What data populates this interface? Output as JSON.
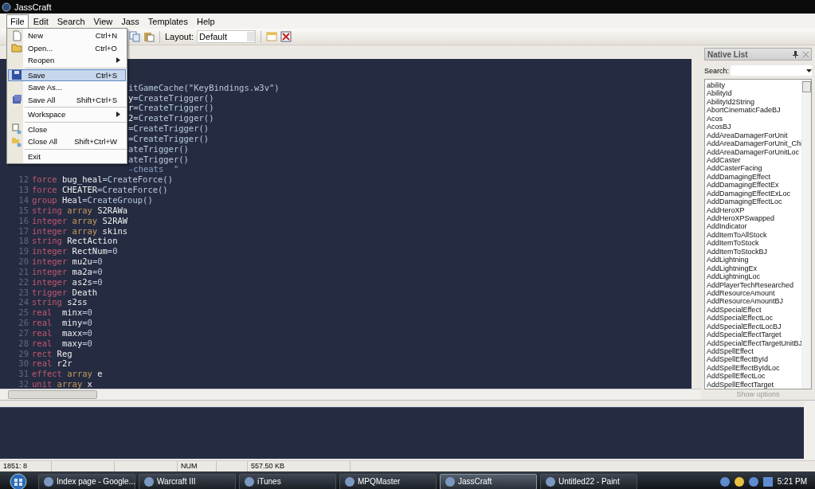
{
  "window": {
    "title": "JassCraft"
  },
  "menu_bar": [
    {
      "label": "File",
      "selected": true
    },
    {
      "label": "Edit",
      "selected": false
    },
    {
      "label": "Search",
      "selected": false
    },
    {
      "label": "View",
      "selected": false
    },
    {
      "label": "Jass",
      "selected": false
    },
    {
      "label": "Templates",
      "selected": false
    },
    {
      "label": "Help",
      "selected": false
    }
  ],
  "file_menu": [
    {
      "kind": "item",
      "label": "New",
      "shortcut": "Ctrl+N",
      "selected": false
    },
    {
      "kind": "item",
      "label": "Open...",
      "shortcut": "Ctrl+O",
      "selected": false
    },
    {
      "kind": "submenu",
      "label": "Reopen",
      "selected": false
    },
    {
      "kind": "separator"
    },
    {
      "kind": "item",
      "label": "Save",
      "shortcut": "Ctrl+S",
      "selected": true
    },
    {
      "kind": "item",
      "label": "Save As...",
      "selected": false
    },
    {
      "kind": "item",
      "label": "Save All",
      "shortcut": "Shift+Ctrl+S",
      "selected": false
    },
    {
      "kind": "separator"
    },
    {
      "kind": "submenu",
      "label": "Workspace",
      "selected": false
    },
    {
      "kind": "separator"
    },
    {
      "kind": "item",
      "label": "Close",
      "selected": false
    },
    {
      "kind": "item",
      "label": "Close All",
      "shortcut": "Shift+Ctrl+W",
      "selected": false
    },
    {
      "kind": "separator"
    },
    {
      "kind": "item",
      "label": "Exit",
      "selected": false
    }
  ],
  "toolbar": {
    "layout_label": "Layout:",
    "layout_value": "Default"
  },
  "editor": {
    "partial_lines": [
      [
        {
          "kind": "call",
          "text": "itGameCache(\"KeyBindings.w3v\")"
        }
      ],
      [
        {
          "kind": "ident",
          "text": "y"
        },
        {
          "kind": "call",
          "text": "=CreateTrigger()"
        }
      ],
      [
        {
          "kind": "ident",
          "text": "r"
        },
        {
          "kind": "call",
          "text": "=CreateTrigger()"
        }
      ],
      [
        {
          "kind": "ident",
          "text": "2"
        },
        {
          "kind": "call",
          "text": "=CreateTrigger()"
        }
      ],
      [
        {
          "kind": "call",
          "text": "=CreateTrigger()"
        }
      ],
      [
        {
          "kind": "call",
          "text": "=CreateTrigger()"
        }
      ],
      [
        {
          "kind": "call",
          "text": "ateTrigger()"
        }
      ],
      [
        {
          "kind": "call",
          "text": "ateTrigger()"
        }
      ],
      [
        {
          "kind": "string",
          "text": "-cheats  \""
        }
      ]
    ],
    "lines": [
      {
        "number": "12",
        "tokens": [
          {
            "kind": "type",
            "text": "force"
          },
          {
            "kind": "ident",
            "text": " bug_heal"
          },
          {
            "kind": "call",
            "text": "=CreateForce()"
          }
        ]
      },
      {
        "number": "13",
        "tokens": [
          {
            "kind": "type",
            "text": "force"
          },
          {
            "kind": "ident",
            "text": " CHEATER"
          },
          {
            "kind": "call",
            "text": "=CreateForce()"
          }
        ]
      },
      {
        "number": "14",
        "tokens": [
          {
            "kind": "type",
            "text": "group"
          },
          {
            "kind": "ident",
            "text": " Heal"
          },
          {
            "kind": "call",
            "text": "=CreateGroup()"
          }
        ]
      },
      {
        "number": "15",
        "tokens": [
          {
            "kind": "type",
            "text": "string"
          },
          {
            "kind": "keyword",
            "text": " array"
          },
          {
            "kind": "ident",
            "text": " S2RAWa"
          }
        ]
      },
      {
        "number": "16",
        "tokens": [
          {
            "kind": "type",
            "text": "integer"
          },
          {
            "kind": "keyword",
            "text": " array"
          },
          {
            "kind": "ident",
            "text": " S2RAW"
          }
        ]
      },
      {
        "number": "17",
        "tokens": [
          {
            "kind": "type",
            "text": "integer"
          },
          {
            "kind": "keyword",
            "text": " array"
          },
          {
            "kind": "ident",
            "text": " skins"
          }
        ]
      },
      {
        "number": "18",
        "tokens": [
          {
            "kind": "type",
            "text": "string"
          },
          {
            "kind": "ident",
            "text": " RectAction"
          }
        ]
      },
      {
        "number": "19",
        "tokens": [
          {
            "kind": "type",
            "text": "integer"
          },
          {
            "kind": "ident",
            "text": " RectNum"
          },
          {
            "kind": "call",
            "text": "=0"
          }
        ]
      },
      {
        "number": "20",
        "tokens": [
          {
            "kind": "type",
            "text": "integer"
          },
          {
            "kind": "ident",
            "text": " mu2u"
          },
          {
            "kind": "call",
            "text": "=0"
          }
        ]
      },
      {
        "number": "21",
        "tokens": [
          {
            "kind": "type",
            "text": "integer"
          },
          {
            "kind": "ident",
            "text": " ma2a"
          },
          {
            "kind": "call",
            "text": "=0"
          }
        ]
      },
      {
        "number": "22",
        "tokens": [
          {
            "kind": "type",
            "text": "integer"
          },
          {
            "kind": "ident",
            "text": " as2s"
          },
          {
            "kind": "call",
            "text": "=0"
          }
        ]
      },
      {
        "number": "23",
        "tokens": [
          {
            "kind": "type",
            "text": "trigger"
          },
          {
            "kind": "ident",
            "text": " Death"
          }
        ]
      },
      {
        "number": "24",
        "tokens": [
          {
            "kind": "type",
            "text": "string"
          },
          {
            "kind": "ident",
            "text": " s2ss"
          }
        ]
      },
      {
        "number": "25",
        "tokens": [
          {
            "kind": "type",
            "text": "real"
          },
          {
            "kind": "ident",
            "text": "  minx"
          },
          {
            "kind": "call",
            "text": "=0"
          }
        ]
      },
      {
        "number": "26",
        "tokens": [
          {
            "kind": "type",
            "text": "real"
          },
          {
            "kind": "ident",
            "text": "  miny"
          },
          {
            "kind": "call",
            "text": "=0"
          }
        ]
      },
      {
        "number": "27",
        "tokens": [
          {
            "kind": "type",
            "text": "real"
          },
          {
            "kind": "ident",
            "text": "  maxx"
          },
          {
            "kind": "call",
            "text": "=0"
          }
        ]
      },
      {
        "number": "28",
        "tokens": [
          {
            "kind": "type",
            "text": "real"
          },
          {
            "kind": "ident",
            "text": "  maxy"
          },
          {
            "kind": "call",
            "text": "=0"
          }
        ]
      },
      {
        "number": "29",
        "tokens": [
          {
            "kind": "type",
            "text": "rect"
          },
          {
            "kind": "ident",
            "text": " Reg"
          }
        ]
      },
      {
        "number": "30",
        "tokens": [
          {
            "kind": "type",
            "text": "real"
          },
          {
            "kind": "ident",
            "text": " r2r"
          }
        ]
      },
      {
        "number": "31",
        "tokens": [
          {
            "kind": "type",
            "text": "effect"
          },
          {
            "kind": "keyword",
            "text": " array"
          },
          {
            "kind": "ident",
            "text": " e"
          }
        ]
      },
      {
        "number": "32",
        "tokens": [
          {
            "kind": "type",
            "text": "unit"
          },
          {
            "kind": "keyword",
            "text": " array"
          },
          {
            "kind": "ident",
            "text": " x"
          }
        ]
      }
    ]
  },
  "native_list": {
    "title": "Native List",
    "search_label": "Search:",
    "items": [
      "ability",
      "AbilityId",
      "AbilityId2String",
      "AbortCinematicFadeBJ",
      "Acos",
      "AcosBJ",
      "AddAreaDamagerForUnit",
      "AddAreaDamagerForUnit_Chi",
      "AddAreaDamagerForUnitLoc",
      "AddCaster",
      "AddCasterFacing",
      "AddDamagingEffect",
      "AddDamagingEffectEx",
      "AddDamagingEffectExLoc",
      "AddDamagingEffectLoc",
      "AddHeroXP",
      "AddHeroXPSwapped",
      "AddIndicator",
      "AddItemToAllStock",
      "AddItemToStock",
      "AddItemToStockBJ",
      "AddLightning",
      "AddLightningEx",
      "AddLightningLoc",
      "AddPlayerTechResearched",
      "AddResourceAmount",
      "AddResourceAmountBJ",
      "AddSpecialEffect",
      "AddSpecialEffectLoc",
      "AddSpecialEffectLocBJ",
      "AddSpecialEffectTarget",
      "AddSpecialEffectTargetUnitBJ",
      "AddSpellEffect",
      "AddSpellEffectById",
      "AddSpellEffectByIdLoc",
      "AddSpellEffectLoc",
      "AddSpellEffectTarget"
    ],
    "show_options": "Show options"
  },
  "status_bar": [
    "1851: 8",
    "NUM",
    "557.50 KB"
  ],
  "taskbar": {
    "tasks": [
      {
        "label": "Index page - Google...",
        "selected": false
      },
      {
        "label": "Warcraft III",
        "selected": false
      },
      {
        "label": "iTunes",
        "selected": false
      },
      {
        "label": "MPQMaster",
        "selected": false
      },
      {
        "label": "JassCraft",
        "selected": true
      },
      {
        "label": "Untitled22 - Paint",
        "selected": false
      }
    ],
    "clock": "5:21 PM"
  }
}
